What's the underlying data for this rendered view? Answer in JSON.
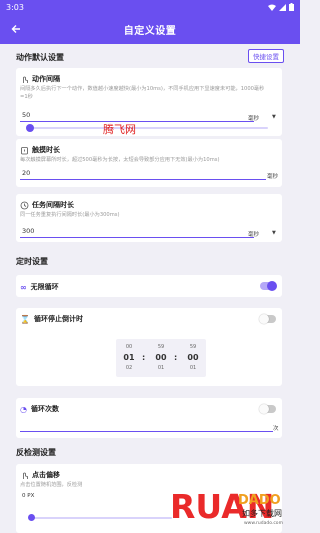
{
  "status_bar": {
    "time": "3:03"
  },
  "app_bar": {
    "title": "自定义设置"
  },
  "action_defaults": {
    "header": "动作默认设置",
    "quick_button": "快捷设置",
    "action_interval": {
      "title": "动作间隔",
      "description": "间隔多久后执行下一个动作，数值越小速度越快(最小为10ms)，不同手机应用下显速度未可能，1000毫秒=1秒",
      "value": "50",
      "unit": "毫秒",
      "slider_fraction": 0.0
    },
    "touch_duration": {
      "title": "触摸时长",
      "description": "每次触摸屏幕所时长，超过500毫秒为长按，太短会导致部分应用下无效(最小为10ms)",
      "value": "20",
      "unit": "毫秒"
    },
    "task_interval": {
      "title": "任务间隔时长",
      "description": "同一任务重复执行间隔时长(最小为300ms)",
      "value": "300",
      "unit": "毫秒"
    }
  },
  "timer_settings": {
    "header": "定时设置",
    "infinite_loop": {
      "label": "无限循环",
      "enabled": true
    },
    "loop_countdown": {
      "label": "循环停止倒计时",
      "enabled": false,
      "picker": {
        "hours": {
          "prev": "00",
          "current": "01",
          "next": "02"
        },
        "minutes": {
          "prev": "59",
          "current": "00",
          "next": "01"
        },
        "seconds": {
          "prev": "59",
          "current": "00",
          "next": "01"
        }
      }
    },
    "loop_count": {
      "label": "循环次数",
      "enabled": false,
      "unit": "次"
    }
  },
  "anti_detection": {
    "header": "反检测设置",
    "click_offset": {
      "title": "点击偏移",
      "description": "点击位置随机范围，反检测",
      "value": "0 PX",
      "slider_fraction": 0.0
    }
  },
  "watermark": "腾飞网",
  "logo": {
    "text_left": "RUAN",
    "text_right": "DADO",
    "slogan": "如多下载网",
    "url": "www.rudado.com"
  },
  "colors": {
    "primary": "#6a4ff0",
    "bg": "#f0eff6"
  }
}
